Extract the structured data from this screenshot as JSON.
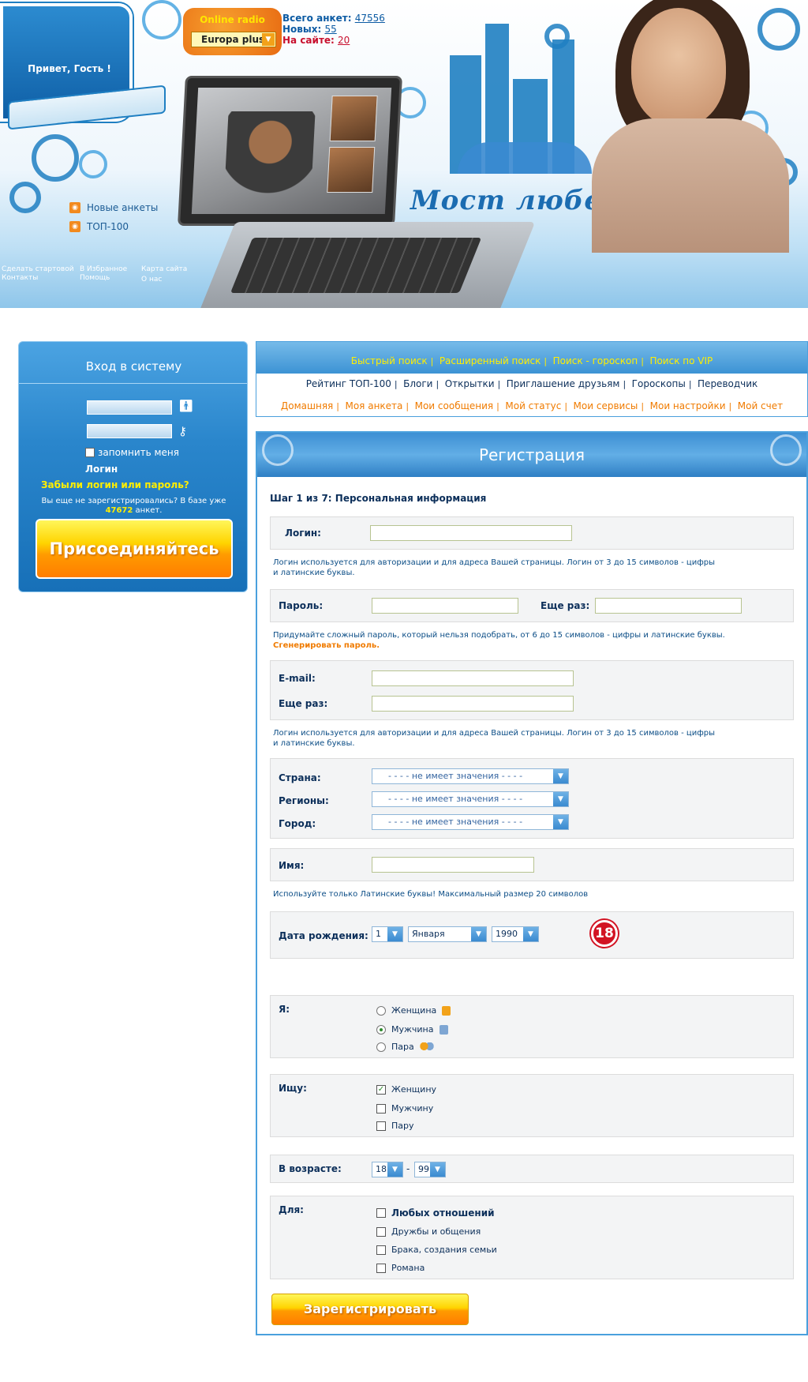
{
  "header": {
    "greeting": "Привет, Гость !",
    "radio_title": "Online radio",
    "radio_station": "Europa plus",
    "stats": {
      "total_label": "Всего анкет:",
      "total_value": "47556",
      "new_label": "Новых:",
      "new_value": "55",
      "online_label": "На сайте:",
      "online_value": "20"
    },
    "logo": "Мост любви",
    "feeds": [
      "Новые анкеты",
      "ТОП-100"
    ],
    "util_links": {
      "home": "Сделать стартовой",
      "contacts": "Контакты",
      "fav": "В  Избранное",
      "help": "Помощь",
      "map": "Карта сайта",
      "about": "О нас"
    }
  },
  "login": {
    "title": "Вход в систему",
    "remember": "запомнить меня",
    "login_button": "Логин",
    "forgot": "Забыли логин или пароль?",
    "not_registered_1": "Вы еще не зарегистрировались? В базе уже",
    "count": "47672",
    "not_registered_2": "анкет.",
    "join": "Присоединяйтесь"
  },
  "nav": {
    "row1": [
      "Быстрый поиск",
      "Расширенный поиск",
      "Поиск - гороскоп",
      "Поиск по VIP"
    ],
    "row2": [
      "Рейтинг ТОП-100",
      "Блоги",
      "Открытки",
      "Приглашение друзьям",
      "Гороскопы",
      "Переводчик"
    ],
    "row3": [
      "Домашняя",
      "Моя анкета",
      "Мои сообщения",
      "Мой статус",
      "Мои сервисы",
      "Мои настройки",
      "Мой счет"
    ]
  },
  "registration": {
    "title": "Регистрация",
    "step": "Шаг 1 из 7:  Персональная информация",
    "login_label": "Логин:",
    "login_hint_1": "Логин используется для авторизации и для адреса Вашей страницы. Логин от 3 до 15 символов - цифры",
    "login_hint_2": "и латинские буквы.",
    "password_label": "Пароль:",
    "password_again_label": "Еще раз:",
    "password_hint": "Придумайте сложный пароль, который нельзя подобрать, от 6 до 15 символов - цифры и латинские буквы.",
    "generate": "Сгенерировать пароль.",
    "email_label": "E-mail:",
    "email_again_label": "Еще раз:",
    "email_hint_1": "Логин используется для авторизации и для адреса Вашей страницы. Логин от 3 до 15 символов - цифры",
    "email_hint_2": "и латинские буквы.",
    "country_label": "Страна:",
    "regions_label": "Регионы:",
    "city_label": "Город:",
    "no_value": "- - - - не имеет значения  - - - -",
    "name_label": "Имя:",
    "name_hint": "Используйте только Латинские буквы! Максимальный размер 20 символов",
    "dob_label": "Дата рождения:",
    "dob_day": "1",
    "dob_month": "Января",
    "dob_year": "1990",
    "age_badge": "18",
    "i_am_label": "Я:",
    "i_am_options": [
      "Женщина",
      "Мужчина",
      "Пара"
    ],
    "seek_label": "Ищу:",
    "seek_options": [
      "Женщину",
      "Мужчину",
      "Пару"
    ],
    "age_label": "В возрасте:",
    "age_from": "18",
    "age_dash": "-",
    "age_to": "99",
    "for_label": "Для:",
    "for_options": [
      "Любых отношений",
      "Дружбы и общения",
      "Брака, создания семьи",
      "Романа"
    ],
    "submit": "Зарегистрировать"
  }
}
